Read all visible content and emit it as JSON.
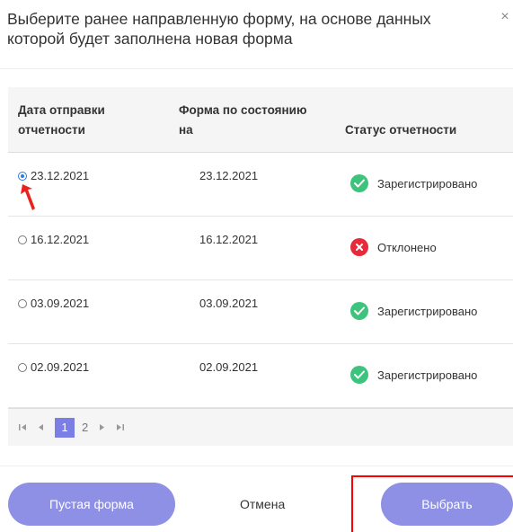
{
  "dialog": {
    "title": "Выберите ранее направленную форму, на основе данных которой будет заполнена новая форма",
    "close_label": "×"
  },
  "table": {
    "headers": {
      "date": "Дата отправки отчетности",
      "form": "Форма по состоянию на",
      "status": "Статус отчетности"
    },
    "rows": [
      {
        "date": "23.12.2021",
        "form": "23.12.2021",
        "status": "Зарегистрировано",
        "status_type": "success",
        "selected": true
      },
      {
        "date": "16.12.2021",
        "form": "16.12.2021",
        "status": "Отклонено",
        "status_type": "error",
        "selected": false
      },
      {
        "date": "03.09.2021",
        "form": "03.09.2021",
        "status": "Зарегистрировано",
        "status_type": "success",
        "selected": false
      },
      {
        "date": "02.09.2021",
        "form": "02.09.2021",
        "status": "Зарегистрировано",
        "status_type": "success",
        "selected": false
      }
    ]
  },
  "pager": {
    "first_icon": "first-page-icon",
    "prev_icon": "prev-page-icon",
    "pages": [
      "1",
      "2"
    ],
    "current_page": "1",
    "next_icon": "next-page-icon",
    "last_icon": "last-page-icon"
  },
  "footer": {
    "empty_label": "Пустая форма",
    "cancel_label": "Отмена",
    "select_label": "Выбрать"
  },
  "colors": {
    "accent": "#8d90e4",
    "pager_active": "#7b7ee4",
    "success": "#3cc47c",
    "error": "#e8293c",
    "radio_selected": "#2a7ae2",
    "annotation_red": "#ff0000"
  }
}
